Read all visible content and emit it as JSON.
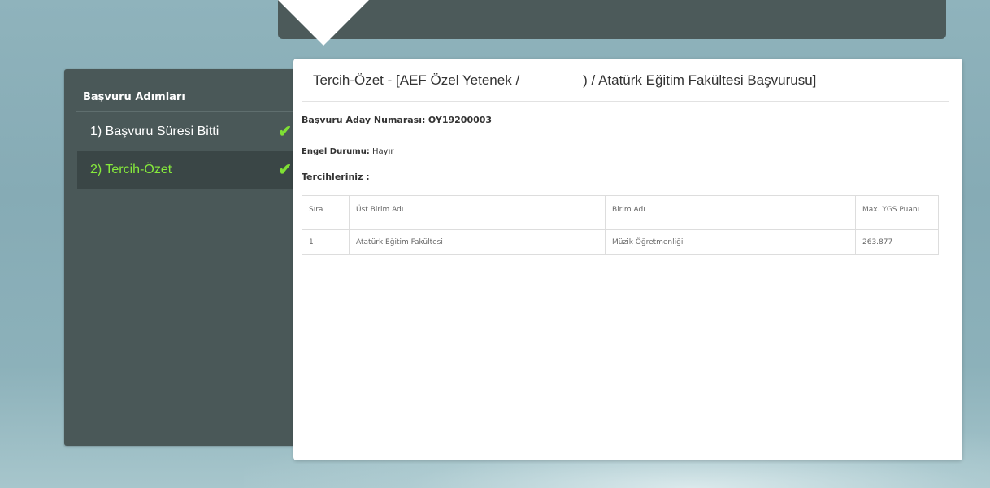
{
  "sidebar": {
    "title": "Başvuru Adımları",
    "steps": [
      {
        "label": "1) Başvuru Süresi Bitti",
        "check": "✔"
      },
      {
        "label": "2) Tercih-Özet",
        "check": "✔"
      }
    ]
  },
  "panel": {
    "title_part1": "Tercih-Özet - [AEF Özel Yetenek /",
    "title_part2": ") / Atatürk Eğitim Fakültesi Başvurusu]",
    "applicant_number_label": "Başvuru Aday Numarası:",
    "applicant_number": "OY19200003",
    "disability_label": "Engel Durumu:",
    "disability_value": "Hayır",
    "preferences_title": "Tercihleriniz :",
    "table": {
      "headers": [
        "Sıra",
        "Üst Birim Adı",
        "Birim Adı",
        "Max. YGS Puanı"
      ],
      "rows": [
        [
          "1",
          "Atatürk Eğitim Fakültesi",
          "Müzik Öğretmenliği",
          "263.877"
        ]
      ]
    }
  },
  "colors": {
    "background": "#8fb3bc",
    "sidebar": "#4a5858",
    "active_step_text": "#86ea3c",
    "check": "#7fe034"
  }
}
